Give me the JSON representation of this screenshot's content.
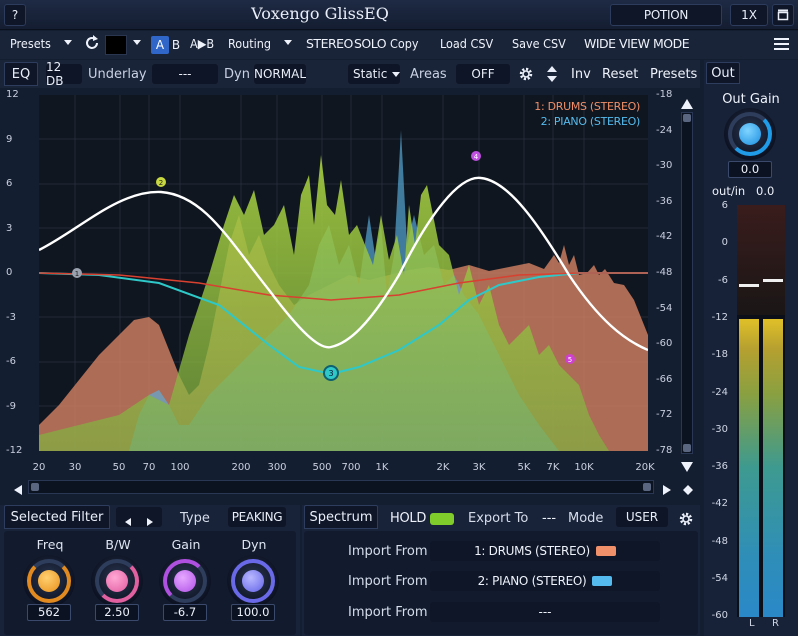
{
  "titlebar": {
    "help": "?",
    "title": "Voxengo GlissEQ",
    "preset": "POTION",
    "scale": "1X"
  },
  "toolbar": {
    "presets": "Presets",
    "a": "A",
    "b": "B",
    "ab_copy": "A▶B",
    "routing": "Routing",
    "stereo": "STEREO",
    "solo": "SOLO",
    "copy": "Copy",
    "load": "Load CSV",
    "save": "Save CSV",
    "wide": "WIDE VIEW MODE"
  },
  "eqbar": {
    "tab": "EQ",
    "db": "12 DB",
    "underlay_label": "Underlay",
    "underlay_value": "---",
    "dyn_label": "Dyn",
    "dyn_value": "NORMAL",
    "static": "Static",
    "areas_label": "Areas",
    "areas_value": "OFF",
    "inv": "Inv",
    "reset": "Reset",
    "presets": "Presets"
  },
  "legend": [
    {
      "text": "1: DRUMS (STEREO)",
      "color": "#f0906a"
    },
    {
      "text": "2: PIANO (STEREO)",
      "color": "#55bbee"
    }
  ],
  "axes": {
    "left": [
      "12",
      "9",
      "6",
      "3",
      "0",
      "-3",
      "-6",
      "-9",
      "-12"
    ],
    "right": [
      "-18",
      "-24",
      "-30",
      "-36",
      "-42",
      "-48",
      "-54",
      "-60",
      "-66",
      "-72",
      "-78"
    ],
    "freq": [
      "20",
      "30",
      "50",
      "70",
      "100",
      "200",
      "300",
      "500",
      "700",
      "1K",
      "2K",
      "3K",
      "5K",
      "7K",
      "10K",
      "20K"
    ]
  },
  "bands": [
    "1",
    "2",
    "3",
    "4",
    "5"
  ],
  "out": {
    "tab": "Out",
    "gain_label": "Out Gain",
    "gain_value": "0.0",
    "outin_label": "out/in",
    "outin_value": "0.0",
    "scale": [
      "6",
      "0",
      "-6",
      "-12",
      "-18",
      "-24",
      "-30",
      "-36",
      "-42",
      "-48",
      "-54",
      "-60"
    ],
    "l": "L",
    "r": "R",
    "level_l": -6.6,
    "level_r": -5.8
  },
  "filter": {
    "title": "Selected Filter",
    "type_label": "Type",
    "type_value": "PEAKING",
    "knobs": [
      {
        "label": "Freq",
        "value": "562",
        "color": "#f0a020"
      },
      {
        "label": "B/W",
        "value": "2.50",
        "color": "#f070b0"
      },
      {
        "label": "Gain",
        "value": "-6.7",
        "color": "#c060f0"
      },
      {
        "label": "Dyn",
        "value": "100.0",
        "color": "#7070f0"
      }
    ]
  },
  "spectrum": {
    "title": "Spectrum",
    "hold": "HOLD",
    "export_label": "Export To",
    "export_value": "---",
    "mode_label": "Mode",
    "mode_value": "USER",
    "import_label": "Import From",
    "imports": [
      {
        "value": "1: DRUMS (STEREO)",
        "color": "#f0906a"
      },
      {
        "value": "2: PIANO (STEREO)",
        "color": "#55bbee"
      },
      {
        "value": "---",
        "color": ""
      }
    ]
  }
}
